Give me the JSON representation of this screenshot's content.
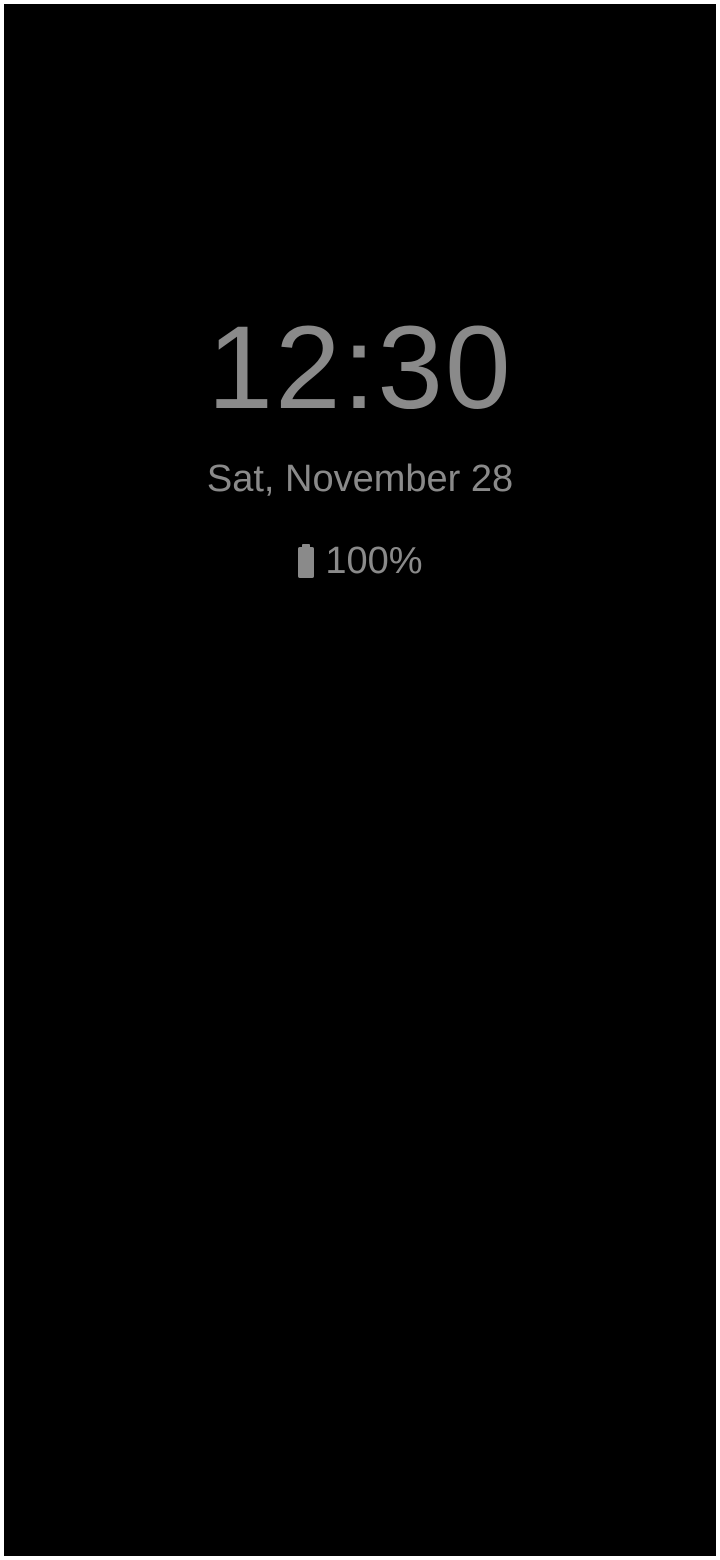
{
  "aod": {
    "time": "12:30",
    "date": "Sat, November 28",
    "battery_percent": "100%",
    "battery_icon": "battery-full-icon"
  },
  "colors": {
    "background": "#000000",
    "text": "#8a8a8a",
    "frame": "#ffffff"
  }
}
